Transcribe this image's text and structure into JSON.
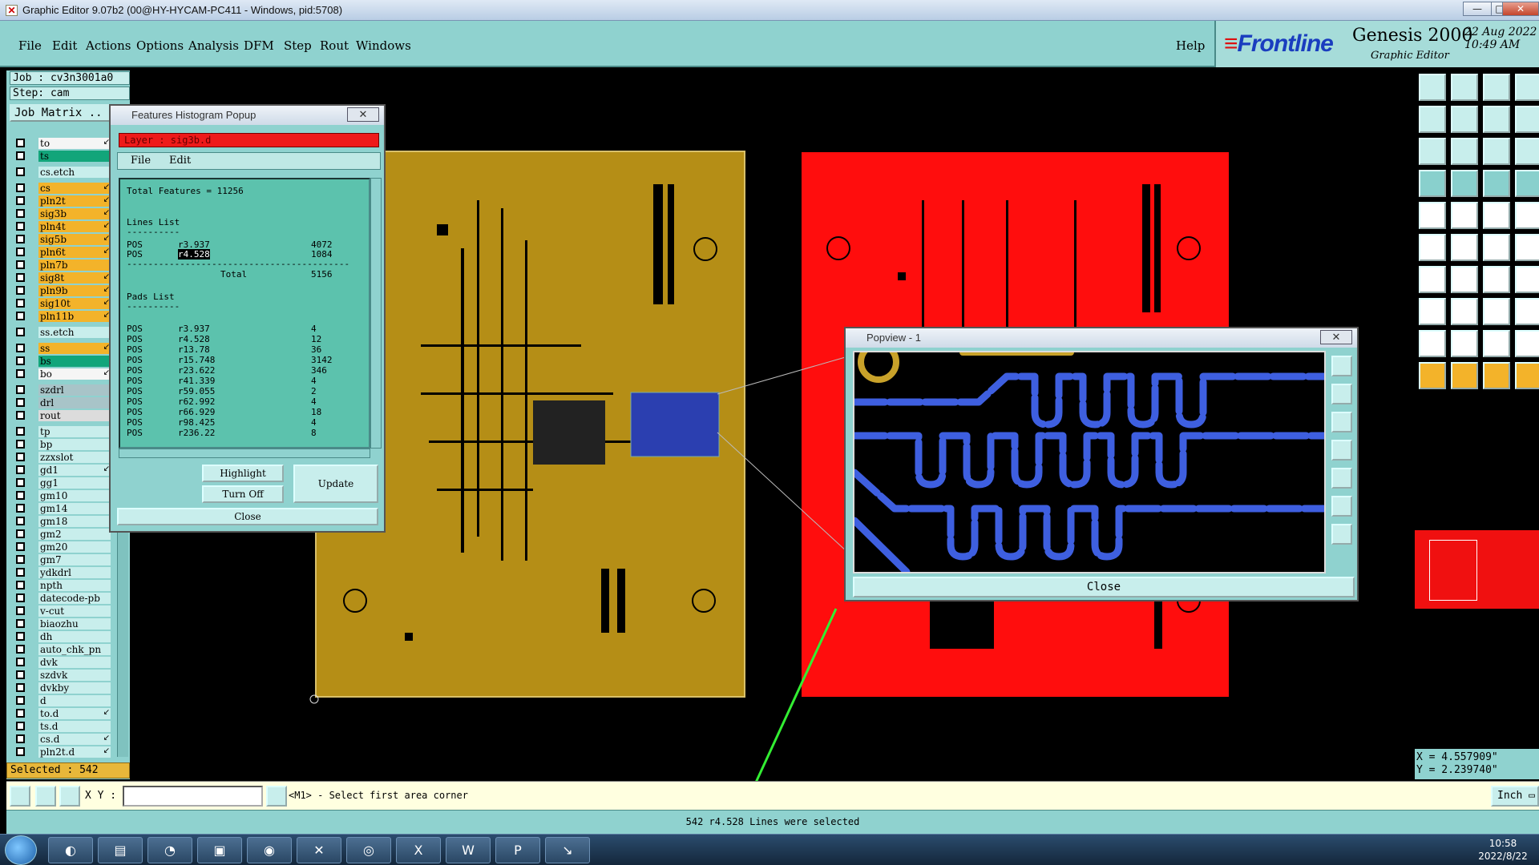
{
  "window": {
    "title": "Graphic Editor 9.07b2 (00@HY-HYCAM-PC411 - Windows, pid:5708)",
    "min_glyph": "—",
    "max_glyph": "□",
    "close_glyph": "✕"
  },
  "menu": {
    "items": [
      "File",
      "Edit",
      "Actions",
      "Options",
      "Analysis",
      "DFM",
      "Step",
      "Rout",
      "Windows"
    ],
    "help": "Help"
  },
  "brand": {
    "logo": "Frontline",
    "product": "Genesis 2000",
    "subtitle": "Graphic Editor",
    "date": "22 Aug 2022",
    "time": "10:49 AM"
  },
  "job": {
    "job_line": "Job : cv3n3001a0",
    "step_line": "Step: cam",
    "matrix_label": "Job Matrix .."
  },
  "layers": [
    {
      "name": "to",
      "color": "#f5f5f5",
      "arrow": "↙"
    },
    {
      "name": "ts",
      "color": "#12a57a",
      "arrow": ""
    },
    {
      "name": "cs.etch",
      "color": "#c8eeec",
      "arrow": ""
    },
    {
      "name": "cs",
      "color": "#f3b32a",
      "arrow": "↙"
    },
    {
      "name": "pln2t",
      "color": "#f3b32a",
      "arrow": "↙"
    },
    {
      "name": "sig3b",
      "color": "#f3b32a",
      "arrow": "↙"
    },
    {
      "name": "pln4t",
      "color": "#f3b32a",
      "arrow": "↙"
    },
    {
      "name": "sig5b",
      "color": "#f3b32a",
      "arrow": "↙"
    },
    {
      "name": "pln6t",
      "color": "#f3b32a",
      "arrow": "↙"
    },
    {
      "name": "pln7b",
      "color": "#f3b32a",
      "arrow": ""
    },
    {
      "name": "sig8t",
      "color": "#f3b32a",
      "arrow": "↙"
    },
    {
      "name": "pln9b",
      "color": "#f3b32a",
      "arrow": "↙"
    },
    {
      "name": "sig10t",
      "color": "#f3b32a",
      "arrow": "↙"
    },
    {
      "name": "pln11b",
      "color": "#f3b32a",
      "arrow": "↙"
    },
    {
      "name": "ss.etch",
      "color": "#c8eeec",
      "arrow": ""
    },
    {
      "name": "ss",
      "color": "#f3b32a",
      "arrow": "↙"
    },
    {
      "name": "bs",
      "color": "#12a57a",
      "arrow": ""
    },
    {
      "name": "bo",
      "color": "#f5f5f5",
      "arrow": "↙"
    },
    {
      "name": "szdrl",
      "color": "#a8c4c8",
      "arrow": ""
    },
    {
      "name": "drl",
      "color": "#a8c4c8",
      "arrow": ""
    },
    {
      "name": "rout",
      "color": "#dcdcdc",
      "arrow": ""
    },
    {
      "name": "tp",
      "color": "#c8eeec",
      "arrow": ""
    },
    {
      "name": "bp",
      "color": "#c8eeec",
      "arrow": ""
    },
    {
      "name": "zzxslot",
      "color": "#c8eeec",
      "arrow": ""
    },
    {
      "name": "gd1",
      "color": "#c8eeec",
      "arrow": "↙"
    },
    {
      "name": "gg1",
      "color": "#c8eeec",
      "arrow": ""
    },
    {
      "name": "gm10",
      "color": "#c8eeec",
      "arrow": ""
    },
    {
      "name": "gm14",
      "color": "#c8eeec",
      "arrow": ""
    },
    {
      "name": "gm18",
      "color": "#c8eeec",
      "arrow": ""
    },
    {
      "name": "gm2",
      "color": "#c8eeec",
      "arrow": ""
    },
    {
      "name": "gm20",
      "color": "#c8eeec",
      "arrow": ""
    },
    {
      "name": "gm7",
      "color": "#c8eeec",
      "arrow": ""
    },
    {
      "name": "ydkdrl",
      "color": "#c8eeec",
      "arrow": ""
    },
    {
      "name": "npth",
      "color": "#c8eeec",
      "arrow": ""
    },
    {
      "name": "datecode-pb",
      "color": "#c8eeec",
      "arrow": ""
    },
    {
      "name": "v-cut",
      "color": "#c8eeec",
      "arrow": ""
    },
    {
      "name": "biaozhu",
      "color": "#c8eeec",
      "arrow": ""
    },
    {
      "name": "dh",
      "color": "#c8eeec",
      "arrow": ""
    },
    {
      "name": "auto_chk_pn",
      "color": "#c8eeec",
      "arrow": ""
    },
    {
      "name": "dvk",
      "color": "#c8eeec",
      "arrow": ""
    },
    {
      "name": "szdvk",
      "color": "#c8eeec",
      "arrow": ""
    },
    {
      "name": "dvkby",
      "color": "#c8eeec",
      "arrow": ""
    },
    {
      "name": "d",
      "color": "#c8eeec",
      "arrow": ""
    },
    {
      "name": "to.d",
      "color": "#c8eeec",
      "arrow": "↙"
    },
    {
      "name": "ts.d",
      "color": "#c8eeec",
      "arrow": ""
    },
    {
      "name": "cs.d",
      "color": "#c8eeec",
      "arrow": "↙"
    },
    {
      "name": "pln2t.d",
      "color": "#c8eeec",
      "arrow": "↙"
    }
  ],
  "selected": "Selected : 542",
  "histogram": {
    "title": "Features Histogram Popup",
    "layer": "Layer :  sig3b.d",
    "menu": [
      "File",
      "Edit"
    ],
    "total_features": "Total Features = 11256",
    "lines_header": "Lines List",
    "pads_header": "Pads List",
    "dashes": "----------",
    "long_dashes": "------------------------------------------",
    "lines": [
      {
        "pol": "POS",
        "sym": "r3.937",
        "count": "4072"
      },
      {
        "pol": "POS",
        "sym": "r4.528",
        "count": "1084"
      }
    ],
    "total_label": "Total",
    "total_value": "5156",
    "pads": [
      {
        "pol": "POS",
        "sym": "r3.937",
        "count": "4"
      },
      {
        "pol": "POS",
        "sym": "r4.528",
        "count": "12"
      },
      {
        "pol": "POS",
        "sym": "r13.78",
        "count": "36"
      },
      {
        "pol": "POS",
        "sym": "r15.748",
        "count": "3142"
      },
      {
        "pol": "POS",
        "sym": "r23.622",
        "count": "346"
      },
      {
        "pol": "POS",
        "sym": "r41.339",
        "count": "4"
      },
      {
        "pol": "POS",
        "sym": "r59.055",
        "count": "2"
      },
      {
        "pol": "POS",
        "sym": "r62.992",
        "count": "4"
      },
      {
        "pol": "POS",
        "sym": "r66.929",
        "count": "18"
      },
      {
        "pol": "POS",
        "sym": "r98.425",
        "count": "4"
      },
      {
        "pol": "POS",
        "sym": "r236.22",
        "count": "8"
      }
    ],
    "highlight_btn": "Highlight",
    "turnoff_btn": "Turn Off",
    "update_btn": "Update",
    "close_btn": "Close"
  },
  "popview": {
    "title": "Popview - 1",
    "close_btn": "Close"
  },
  "coords": {
    "x": "X = 4.557909\"",
    "y": "Y = 2.239740\""
  },
  "command": {
    "xy_label": "X Y :",
    "xy_value": "",
    "prompt": "<M1> - Select first area corner",
    "unit": "Inch"
  },
  "status": "542 r4.528 Lines were selected",
  "clock": {
    "time": "10:58",
    "date": "2022/8/22"
  },
  "colors": {
    "panel": "#8fd2cf",
    "gold_board": "#b58e16",
    "red_board": "#ff0d0d",
    "trace": "#3355dd",
    "highlight": "#12a57a"
  }
}
